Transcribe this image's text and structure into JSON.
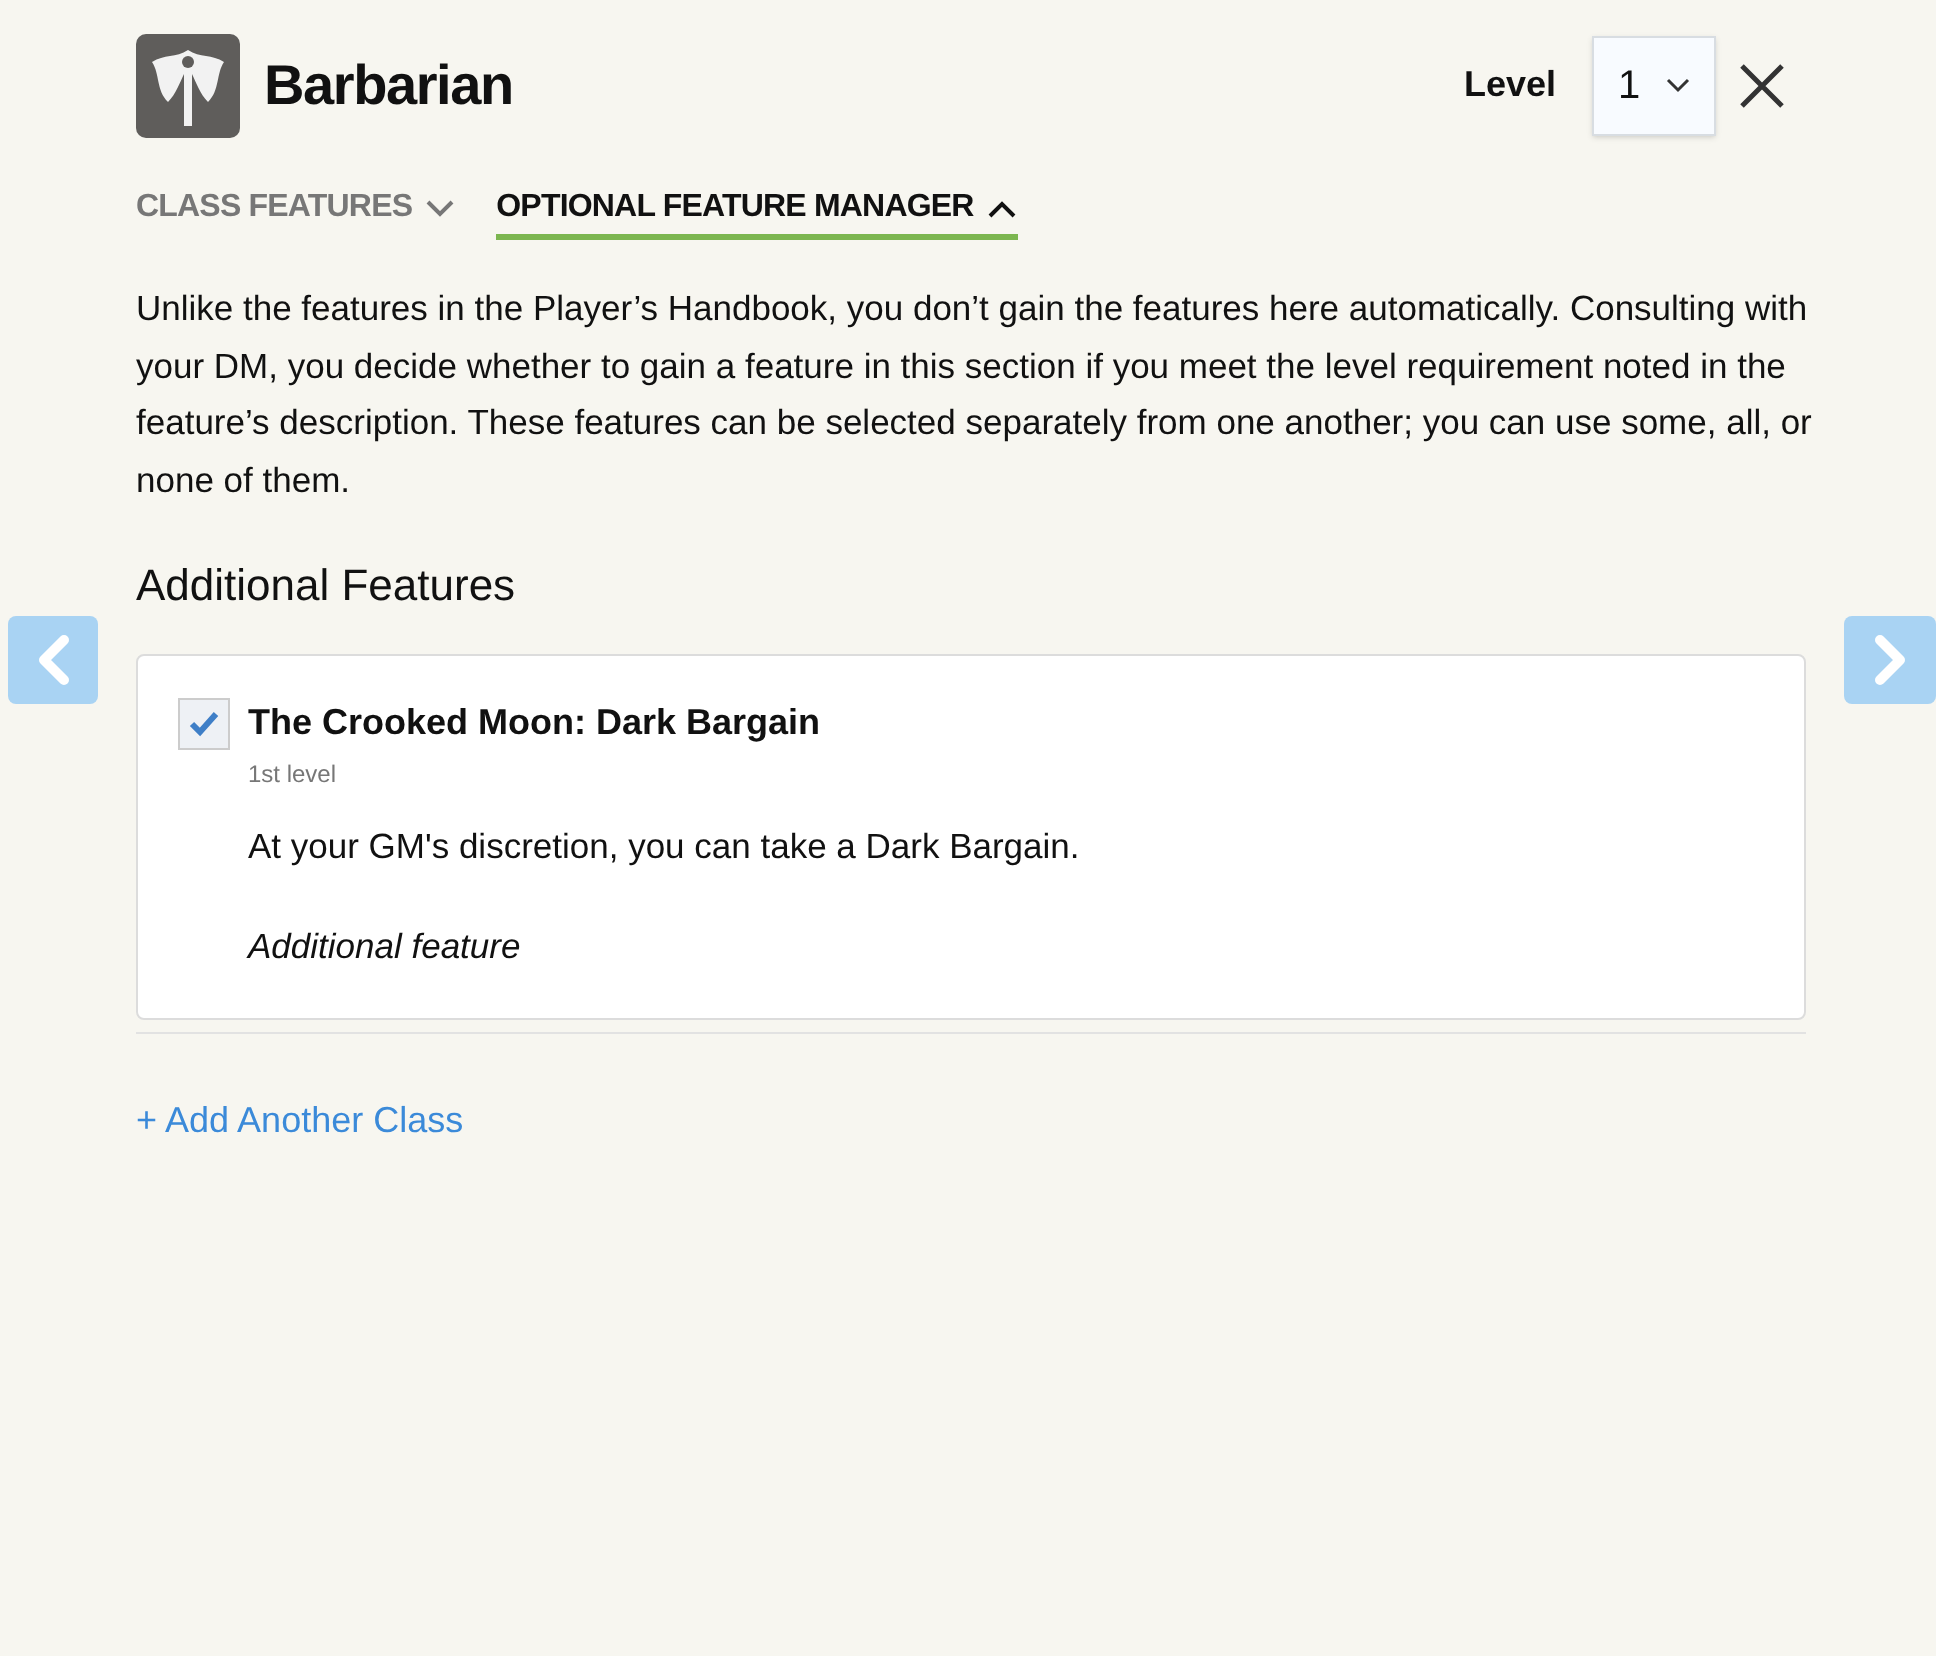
{
  "header": {
    "title": "Barbarian",
    "level_label": "Level",
    "level_value": "1"
  },
  "tabs": [
    {
      "label": "CLASS FEATURES",
      "selected": false,
      "expanded": false
    },
    {
      "label": "OPTIONAL FEATURE MANAGER",
      "selected": true,
      "expanded": true
    }
  ],
  "intro": "Unlike the features in the Player’s Handbook, you don’t gain the features here automatically. Consulting with your DM, you decide whether to gain a feature in this section if you meet the level requirement noted in the feature’s description. These features can be selected separately from one another; you can use some, all, or none of them.",
  "section_title": "Additional Features",
  "features": [
    {
      "name": "The Crooked Moon: Dark Bargain",
      "checked": true,
      "level": "1st level",
      "description": "At your GM's discretion, you can take a Dark Bargain.",
      "source": "Additional feature"
    }
  ],
  "add_class_link": "+ Add Another Class"
}
